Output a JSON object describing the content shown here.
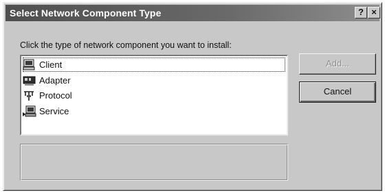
{
  "window": {
    "title": "Select Network Component Type",
    "help_glyph": "?",
    "close_glyph": "×"
  },
  "prompt": "Click the type of network component you want to install:",
  "components": [
    {
      "label": "Client",
      "icon": "client-computer-icon",
      "selected": true
    },
    {
      "label": "Adapter",
      "icon": "network-adapter-icon",
      "selected": false
    },
    {
      "label": "Protocol",
      "icon": "protocol-plug-icon",
      "selected": false
    },
    {
      "label": "Service",
      "icon": "service-computer-icon",
      "selected": false
    }
  ],
  "description": "",
  "buttons": {
    "add": "Add...",
    "cancel": "Cancel"
  },
  "colors": {
    "titlebar": "#4e4e4e",
    "face": "#c8c8c8",
    "disabled_text": "#8f8f8f"
  }
}
